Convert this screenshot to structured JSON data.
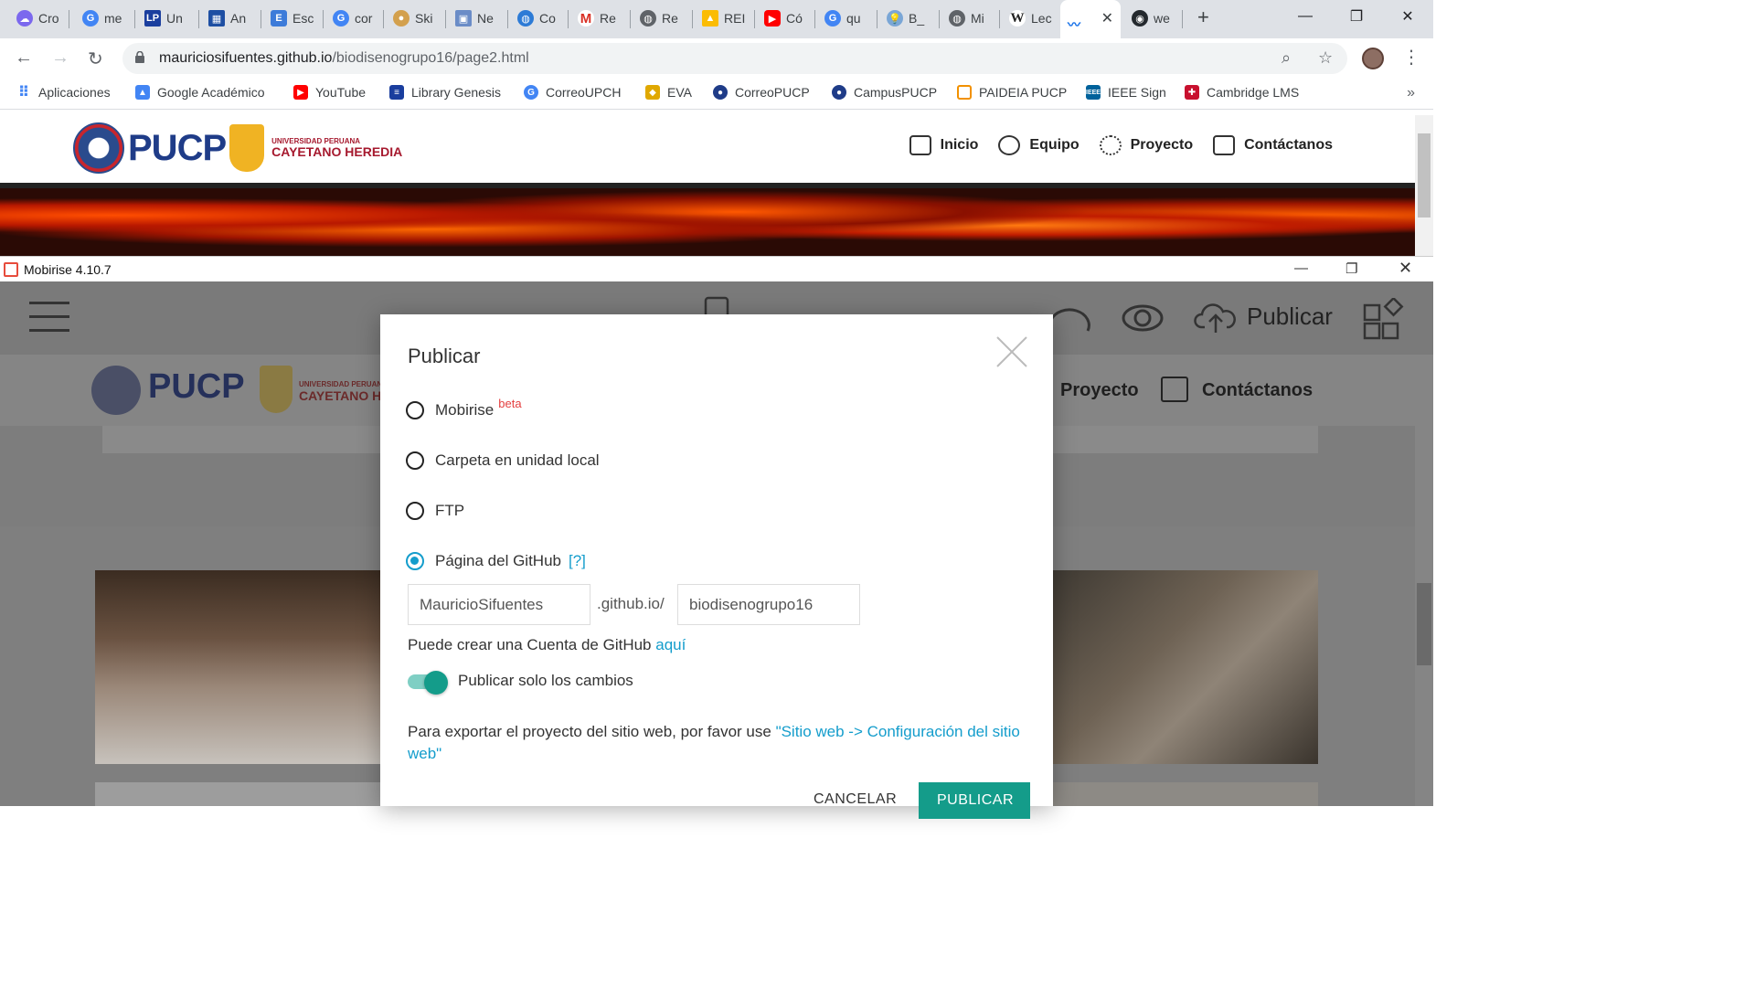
{
  "browser": {
    "tabs": [
      {
        "label": "Cro",
        "icon": "cloud-icon",
        "color": "#7b68ee"
      },
      {
        "label": "me",
        "icon": "google-icon",
        "color": "#4285f4"
      },
      {
        "label": "Un",
        "icon": "lp-icon",
        "color": "#1a3e9e"
      },
      {
        "label": "An",
        "icon": "document-icon",
        "color": "#1e4fa3"
      },
      {
        "label": "Esc",
        "icon": "doc-icon",
        "color": "#3d7bd9"
      },
      {
        "label": "cor",
        "icon": "google-icon",
        "color": "#4285f4"
      },
      {
        "label": "Ski",
        "icon": "plate-icon",
        "color": "#d3a04d"
      },
      {
        "label": "Ne",
        "icon": "image-icon",
        "color": "#6a8cc7"
      },
      {
        "label": "Co",
        "icon": "globe-icon",
        "color": "#2d7bd6"
      },
      {
        "label": "Re",
        "icon": "gmail-icon",
        "color": "#d93025"
      },
      {
        "label": "Re",
        "icon": "world-icon",
        "color": "#5f6368"
      },
      {
        "label": "REI",
        "icon": "drive-icon",
        "color": "#fbbc04"
      },
      {
        "label": "Có",
        "icon": "youtube-icon",
        "color": "#ff0000"
      },
      {
        "label": "qu",
        "icon": "google-icon",
        "color": "#4285f4"
      },
      {
        "label": "B_",
        "icon": "bulb-icon",
        "color": "#7aa6d6"
      },
      {
        "label": "Mi",
        "icon": "world-icon",
        "color": "#5f6368"
      },
      {
        "label": "Lec",
        "icon": "wikipedia-icon",
        "color": "#222222"
      },
      {
        "label": "",
        "icon": "audio-wave-icon",
        "color": "#1a73e8"
      },
      {
        "label": "we",
        "icon": "github-icon",
        "color": "#24292e"
      }
    ],
    "url_domain": "mauriciosifuentes.github.io",
    "url_path": "/biodisenogrupo16/page2.html",
    "bookmarks": [
      {
        "label": "Aplicaciones",
        "icon": "apps-grid-icon",
        "color": "#4285f4"
      },
      {
        "label": "Google Académico",
        "icon": "scholar-icon",
        "color": "#4285f4"
      },
      {
        "label": "YouTube",
        "icon": "youtube-icon",
        "color": "#ff0000"
      },
      {
        "label": "Library Genesis",
        "icon": "library-icon",
        "color": "#1a3e9e"
      },
      {
        "label": "CorreoUPCH",
        "icon": "google-icon",
        "color": "#4285f4"
      },
      {
        "label": "EVA",
        "icon": "shield-icon",
        "color": "#e0a800"
      },
      {
        "label": "CorreoPUCP",
        "icon": "pucp-seal-icon",
        "color": "#1f3c88"
      },
      {
        "label": "CampusPUCP",
        "icon": "pucp-seal-icon",
        "color": "#1f3c88"
      },
      {
        "label": "PAIDEIA PUCP",
        "icon": "paideia-icon",
        "color": "#f29100"
      },
      {
        "label": "IEEE Sign",
        "icon": "ieee-icon",
        "color": "#00629b"
      },
      {
        "label": "Cambridge LMS",
        "icon": "cambridge-icon",
        "color": "#c8102e"
      }
    ]
  },
  "website": {
    "logo_text": "PUCP",
    "upch_line1": "UNIVERSIDAD PERUANA",
    "upch_line2": "CAYETANO HEREDIA",
    "nav": [
      {
        "label": "Inicio",
        "icon": "laptop-icon"
      },
      {
        "label": "Equipo",
        "icon": "smiley-icon"
      },
      {
        "label": "Proyecto",
        "icon": "gear-icon"
      },
      {
        "label": "Contáctanos",
        "icon": "share-icon"
      }
    ]
  },
  "mobirise": {
    "title": "Mobirise 4.10.7",
    "publish_label": "Publicar",
    "behind_nav": {
      "proyecto": "Proyecto",
      "contactanos": "Contáctanos",
      "logo": "PUCP",
      "upch_line1": "UNIVERSIDAD PERUANA",
      "upch_line2": "CAYETANO HE"
    }
  },
  "modal": {
    "title": "Publicar",
    "options": [
      {
        "label": "Mobirise",
        "suffix": "beta",
        "selected": false
      },
      {
        "label": "Carpeta en unidad local",
        "selected": false
      },
      {
        "label": "FTP",
        "selected": false
      },
      {
        "label": "Página del GitHub",
        "help": "[?]",
        "selected": true
      }
    ],
    "github_user": "MauricioSifuentes",
    "github_domain": ".github.io/",
    "github_repo": "biodisenogrupo16",
    "account_note": "Puede crear una Cuenta de GitHub",
    "account_link": "aquí",
    "toggle_label": "Publicar solo los cambios",
    "toggle_on": true,
    "export_note": "Para exportar el proyecto del sitio web, por favor use",
    "export_link": "\"Sitio web -> Configuración del sitio web\"",
    "cancel_label": "CANCELAR",
    "publish_label": "PUBLICAR",
    "accent": "#149c8a",
    "link_color": "#149dcc"
  }
}
